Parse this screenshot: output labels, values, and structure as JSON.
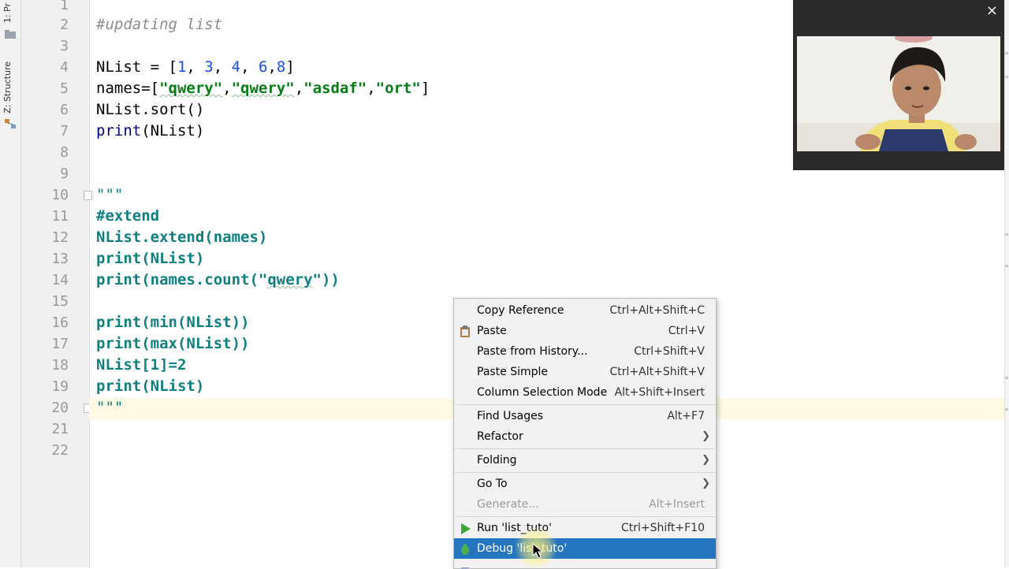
{
  "tool_window_tabs": {
    "project": "1: Pr",
    "structure": "Z: Structure"
  },
  "editor": {
    "line_numbers": [
      "1",
      "2",
      "3",
      "4",
      "5",
      "6",
      "7",
      "8",
      "9",
      "10",
      "11",
      "12",
      "13",
      "14",
      "15",
      "16",
      "17",
      "18",
      "19",
      "20",
      "21",
      "22"
    ],
    "lines": {
      "l2": "#updating list",
      "l4_a": "NList = [",
      "l4_n1": "1",
      "l4_c1": ", ",
      "l4_n2": "3",
      "l4_c2": ", ",
      "l4_n3": "4",
      "l4_c3": ", ",
      "l4_n4": "6",
      "l4_c4": ",",
      "l4_n5": "8",
      "l4_b": "]",
      "l5_a": "names=[",
      "l5_s1": "\"qwery\"",
      "l5_c1": ",",
      "l5_s2": "\"qwery\"",
      "l5_c2": ",",
      "l5_s3": "\"asdaf\"",
      "l5_c3": ",",
      "l5_s4": "\"ort\"",
      "l5_b": "]",
      "l6": "NList.sort()",
      "l7_fn": "print",
      "l7_rest": "(NList)",
      "l10": "\"\"\"",
      "l11": "#extend",
      "l12": "NList.extend(names)",
      "l13": "print(NList)",
      "l14_a": "print(names.count(\"",
      "l14_sq": "qwery",
      "l14_b": "\"))",
      "l16": "print(min(NList))",
      "l17": "print(max(NList))",
      "l18": "NList[1]=2",
      "l19": "print(NList)",
      "l20": "\"\"\""
    }
  },
  "video_overlay": {
    "close_label": "×"
  },
  "context_menu": {
    "items": [
      {
        "label": "Copy Reference",
        "shortcut": "Ctrl+Alt+Shift+C"
      },
      {
        "label": "Paste",
        "shortcut": "Ctrl+V",
        "icon": "clipboard-icon"
      },
      {
        "label": "Paste from History...",
        "shortcut": "Ctrl+Shift+V"
      },
      {
        "label": "Paste Simple",
        "shortcut": "Ctrl+Alt+Shift+V"
      },
      {
        "label": "Column Selection Mode",
        "shortcut": "Alt+Shift+Insert"
      },
      {
        "label": "Find Usages",
        "shortcut": "Alt+F7"
      },
      {
        "label": "Refactor",
        "submenu": true
      },
      {
        "label": "Folding",
        "submenu": true
      },
      {
        "label": "Go To",
        "submenu": true
      },
      {
        "label": "Generate...",
        "shortcut": "Alt+Insert",
        "disabled": true
      },
      {
        "label": "Run 'list_tuto'",
        "shortcut": "Ctrl+Shift+F10",
        "icon": "run-icon"
      },
      {
        "label": "Debug 'list_tuto'",
        "icon": "debug-icon",
        "selected": true
      }
    ],
    "colors": {
      "selection": "#2675bf",
      "run_icon": "#3fa535",
      "debug_icon": "#4caf50"
    }
  }
}
